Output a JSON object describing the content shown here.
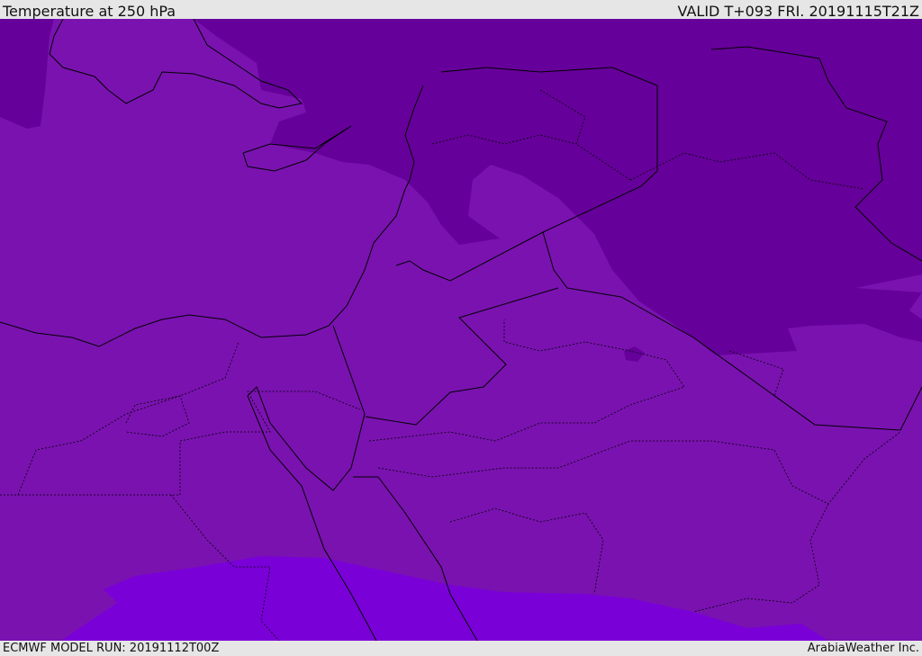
{
  "header": {
    "title": "Temperature at 250 hPa",
    "valid": "VALID T+093 FRI. 20191115T21Z"
  },
  "footer": {
    "model_run": "ECMWF MODEL RUN: 20191112T00Z",
    "credit": "ArabiaWeather Inc."
  },
  "colors": {
    "base": "#7a12b0",
    "cold": "#66009a",
    "warm": "#7a00d8",
    "line": "#000000"
  }
}
